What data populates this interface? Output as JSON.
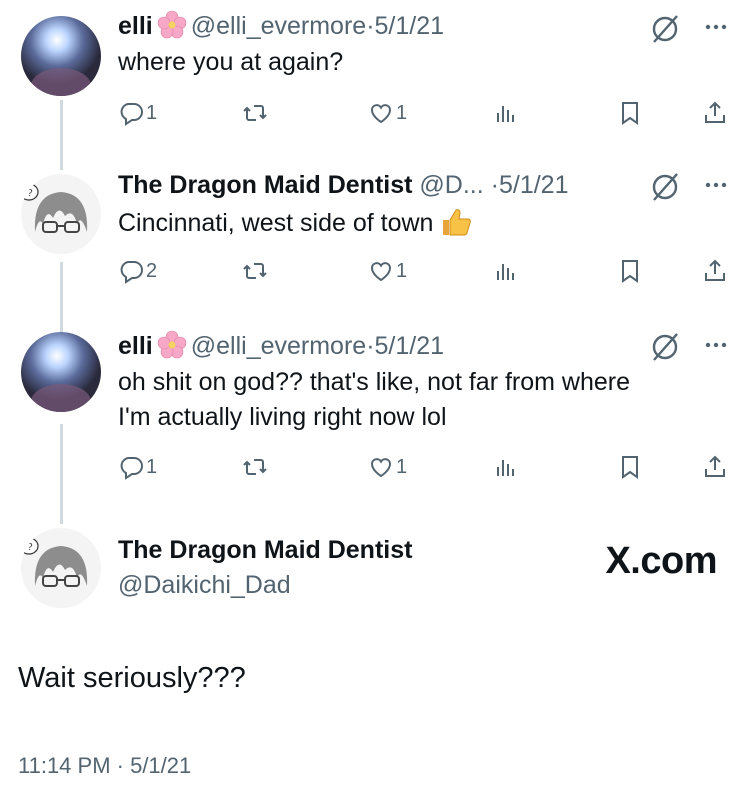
{
  "tweets": [
    {
      "name": "elli",
      "handle": "@elli_evermore",
      "sep": "·",
      "date": "5/1/21",
      "text": "where you at again?",
      "reply_count": "1",
      "retweet_count": "",
      "like_count": "1"
    },
    {
      "name": "The Dragon Maid Dentist",
      "handle": "@D...",
      "sep": "·",
      "date": "5/1/21",
      "text": "Cincinnati, west side of town",
      "reply_count": "2",
      "retweet_count": "",
      "like_count": "1"
    },
    {
      "name": "elli",
      "handle": "@elli_evermore",
      "sep": "·",
      "date": "5/1/21",
      "text_line1": "oh shit on god?? that's like, not far from where",
      "text_line2": "I'm actually living right now lol",
      "reply_count": "1",
      "retweet_count": "",
      "like_count": "1"
    }
  ],
  "main_tweet": {
    "name": "The Dragon Maid Dentist",
    "handle": "@Daikichi_Dad",
    "text": "Wait seriously???",
    "timestamp": "11:14 PM · 5/1/21"
  },
  "watermark": "X.com",
  "icons": [
    "cherry-blossom-icon",
    "grok-icon",
    "more-icon",
    "reply-icon",
    "retweet-icon",
    "like-icon",
    "views-icon",
    "bookmark-icon",
    "share-icon",
    "thumbs-up-icon"
  ],
  "colors": {
    "text": "#0f1419",
    "secondary": "#536471",
    "thread_line": "#cfd9de",
    "background": "#ffffff"
  }
}
